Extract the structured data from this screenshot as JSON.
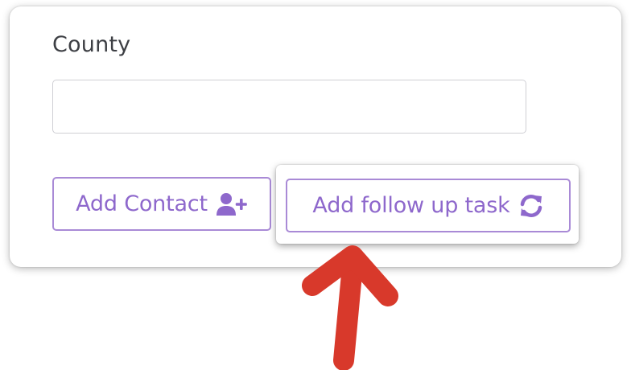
{
  "form": {
    "county_label": "County",
    "county_value": "",
    "county_placeholder": ""
  },
  "buttons": {
    "add_contact_label": "Add Contact",
    "add_contact_icon": "user-plus-icon",
    "add_followup_label": "Add follow up task",
    "add_followup_icon": "sync-icon"
  },
  "colors": {
    "accent": "#8e68cc",
    "button_border": "#a98ad6",
    "annotation_arrow": "#d8392b"
  }
}
